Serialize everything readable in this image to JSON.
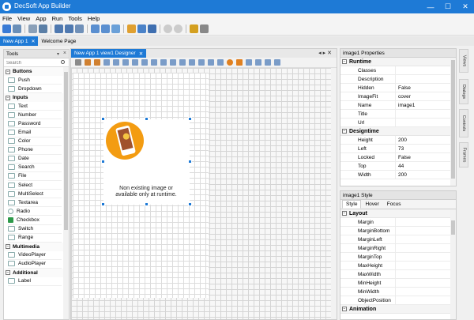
{
  "window": {
    "title": "DecSoft App Builder",
    "min": "—",
    "max": "☐",
    "close": "✕"
  },
  "menu": [
    "File",
    "View",
    "App",
    "Run",
    "Tools",
    "Help"
  ],
  "doc_tabs": {
    "active": "New App 1",
    "close": "✕",
    "other": "Welcome Page"
  },
  "tools": {
    "title": "Tools",
    "search_placeholder": "Search",
    "groups": [
      {
        "name": "Buttons",
        "items": [
          "Push",
          "Dropdown"
        ]
      },
      {
        "name": "Inputs",
        "items": [
          "Text",
          "Number",
          "Password",
          "Email",
          "Color",
          "Phone",
          "Date",
          "Search",
          "File",
          "Select",
          "MultiSelect",
          "Textarea",
          "Radio",
          "Checkbox",
          "Switch",
          "Range"
        ]
      },
      {
        "name": "Multimedia",
        "items": [
          "VideoPlayer",
          "AudioPlayer"
        ]
      },
      {
        "name": "Additional",
        "items": [
          "Label"
        ]
      }
    ]
  },
  "designer": {
    "tab": "New App 1 view1 Designer",
    "image_text": "Non existing image or available only at runtime."
  },
  "properties": {
    "title": "image1 Properties",
    "groups": [
      {
        "name": "Runtime",
        "rows": [
          [
            "Classes",
            ""
          ],
          [
            "Description",
            ""
          ],
          [
            "Hidden",
            "False"
          ],
          [
            "ImageFit",
            "cover"
          ],
          [
            "Name",
            "image1"
          ],
          [
            "Title",
            ""
          ],
          [
            "Url",
            ""
          ]
        ]
      },
      {
        "name": "Designtime",
        "rows": [
          [
            "Height",
            "200"
          ],
          [
            "Left",
            "73"
          ],
          [
            "Locked",
            "False"
          ],
          [
            "Top",
            "44"
          ],
          [
            "Width",
            "200"
          ]
        ]
      }
    ]
  },
  "style": {
    "title": "image1 Style",
    "tabs": [
      "Style",
      "Hover",
      "Focus"
    ],
    "groups": [
      {
        "name": "Layout",
        "rows": [
          "Margin",
          "MarginBottom",
          "MarginLeft",
          "MarginRight",
          "MarginTop",
          "MaxHeight",
          "MaxWidth",
          "MinHeight",
          "MinWidth",
          "ObjectPosition"
        ]
      },
      {
        "name": "Animation",
        "rows": []
      }
    ]
  },
  "side_tabs": [
    "Views",
    "Dialogs",
    "Controls",
    "Frames"
  ],
  "colors": {
    "accent": "#1e7ad6",
    "image_circle": "#f39c12"
  }
}
